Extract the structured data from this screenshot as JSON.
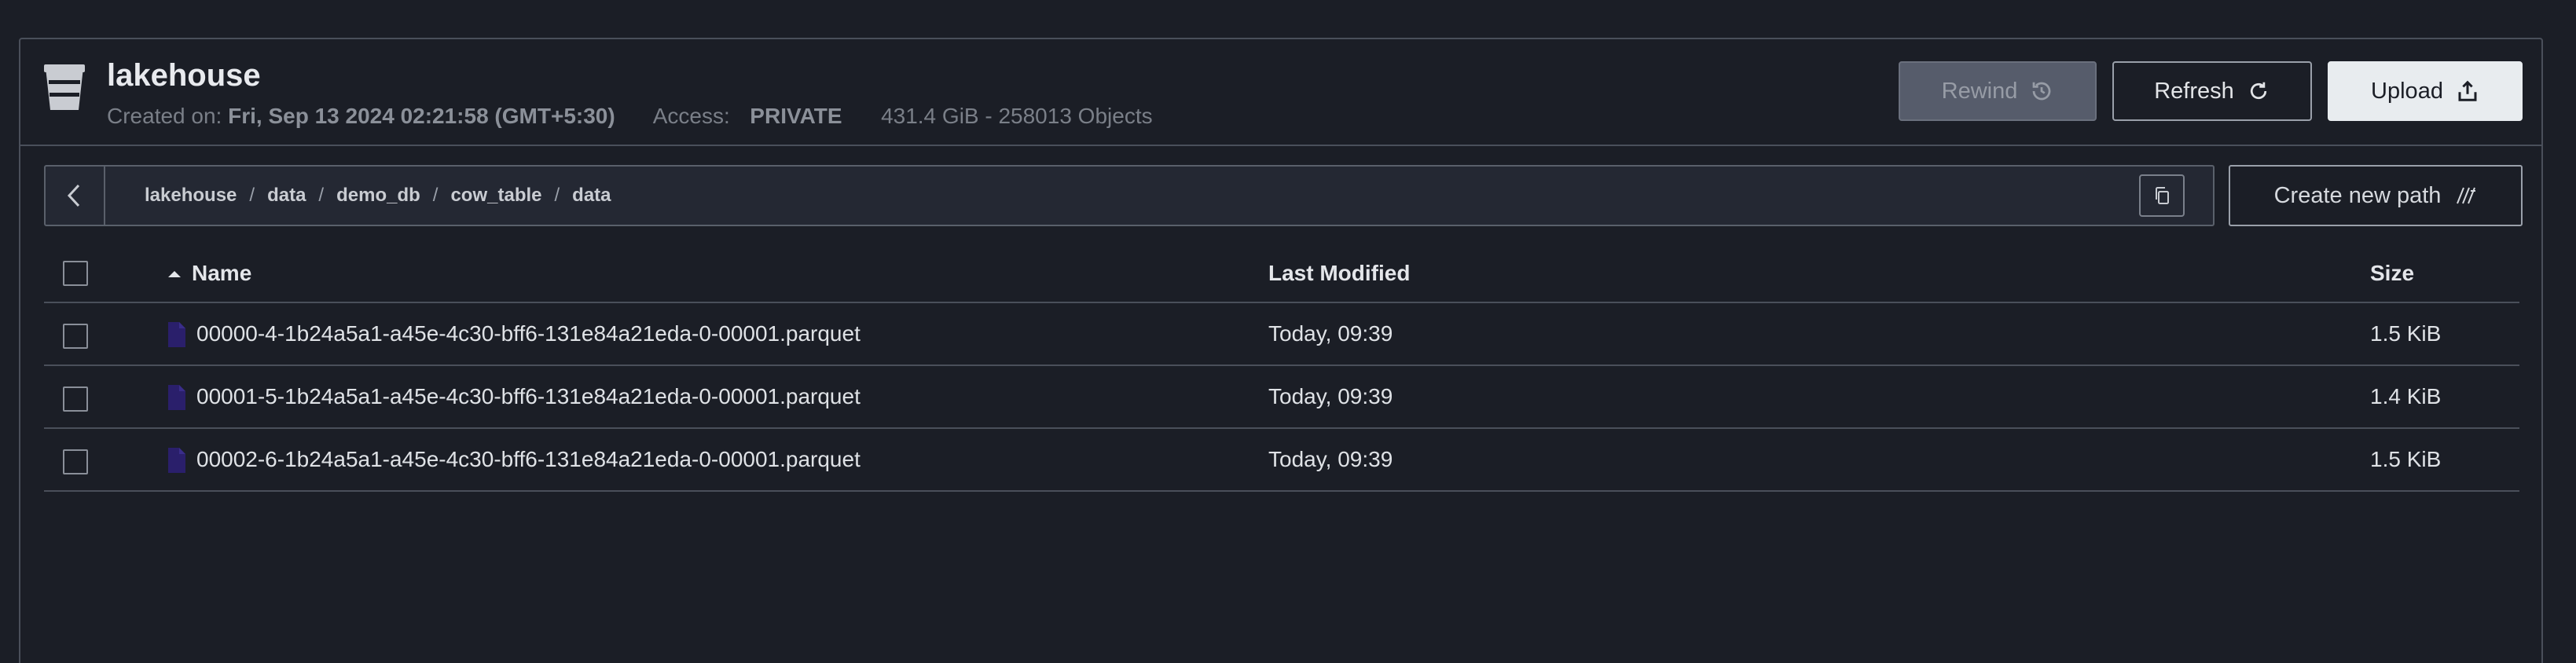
{
  "bucket": {
    "name": "lakehouse",
    "created_label": "Created on:",
    "created_value": "Fri, Sep 13 2024 02:21:58 (GMT+5:30)",
    "access_label": "Access:",
    "access_value": "PRIVATE",
    "usage": "431.4 GiB - 258013 Objects"
  },
  "actions": {
    "rewind": "Rewind",
    "refresh": "Refresh",
    "upload": "Upload"
  },
  "path": {
    "crumbs": [
      "lakehouse",
      "data",
      "demo_db",
      "cow_table",
      "data"
    ],
    "separator": "/"
  },
  "create_path_label": "Create new path",
  "table": {
    "headers": {
      "name": "Name",
      "modified": "Last Modified",
      "size": "Size"
    },
    "rows": [
      {
        "name": "00000-4-1b24a5a1-a45e-4c30-bff6-131e84a21eda-0-00001.parquet",
        "modified": "Today, 09:39",
        "size": "1.5 KiB"
      },
      {
        "name": "00001-5-1b24a5a1-a45e-4c30-bff6-131e84a21eda-0-00001.parquet",
        "modified": "Today, 09:39",
        "size": "1.4 KiB"
      },
      {
        "name": "00002-6-1b24a5a1-a45e-4c30-bff6-131e84a21eda-0-00001.parquet",
        "modified": "Today, 09:39",
        "size": "1.5 KiB"
      }
    ]
  },
  "icons": {
    "bucket": "bucket-icon",
    "rewind": "history-icon",
    "refresh": "refresh-icon",
    "upload": "upload-icon",
    "back": "chevron-left-icon",
    "copy": "copy-icon",
    "new_path": "new-path-icon",
    "sort": "sort-ascending-icon",
    "file": "file-icon"
  },
  "colors": {
    "background": "#1b1e26",
    "file_icon": "#2a1f6b",
    "upload_bg": "#e8ecef"
  }
}
